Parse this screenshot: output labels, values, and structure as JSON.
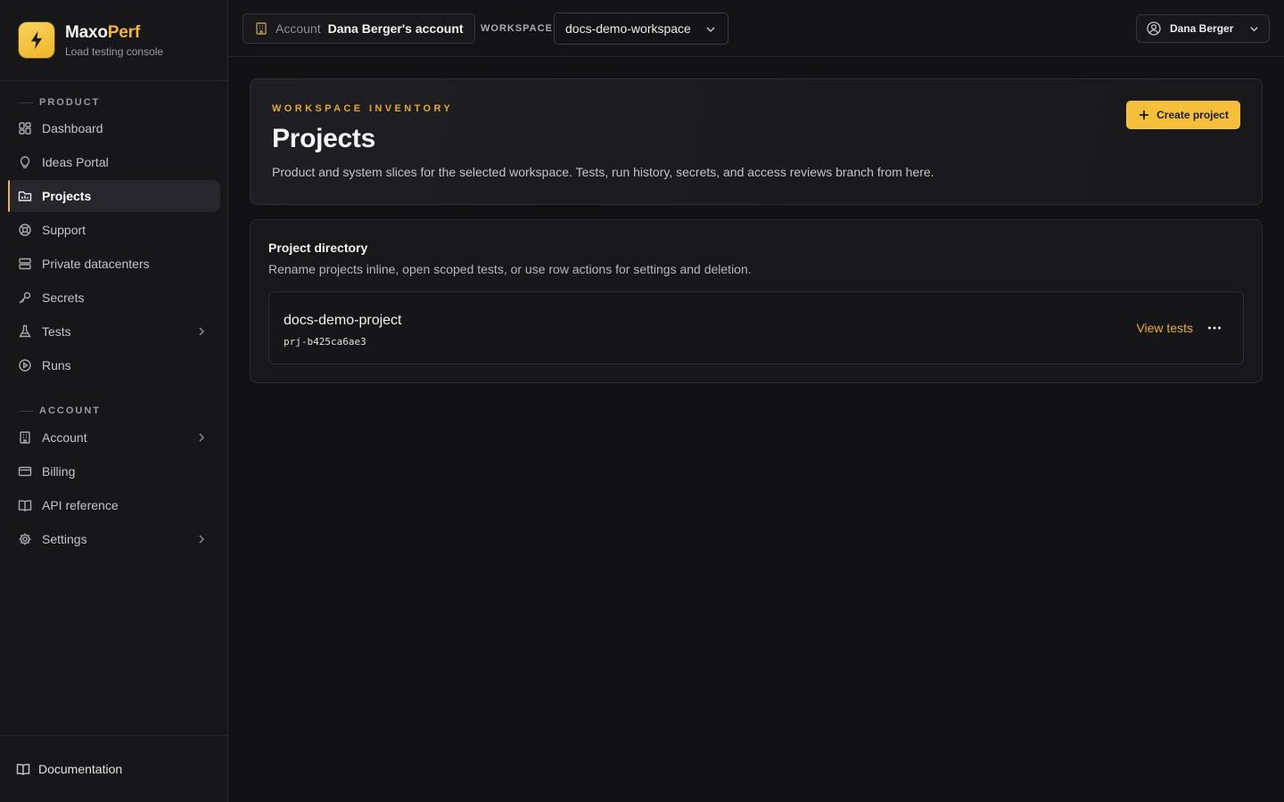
{
  "brand": {
    "name_main": "Maxo",
    "name_accent": "Perf",
    "subtitle": "Load testing console",
    "logo_icon": "lightning-bolt-icon",
    "accent_color": "#f2b53a"
  },
  "sidebar": {
    "product_label": "PRODUCT",
    "product_items": [
      {
        "label": "Dashboard",
        "icon": "grid-icon"
      },
      {
        "label": "Ideas Portal",
        "icon": "lightbulb-icon"
      },
      {
        "label": "Projects",
        "icon": "folder-chart-icon",
        "active": true
      },
      {
        "label": "Support",
        "icon": "lifebuoy-icon"
      },
      {
        "label": "Private datacenters",
        "icon": "server-icon"
      },
      {
        "label": "Secrets",
        "icon": "key-icon"
      },
      {
        "label": "Tests",
        "icon": "flask-icon",
        "expandable": true
      },
      {
        "label": "Runs",
        "icon": "play-circle-icon"
      }
    ],
    "account_label": "ACCOUNT",
    "account_items": [
      {
        "label": "Account",
        "icon": "building-icon",
        "expandable": true
      },
      {
        "label": "Billing",
        "icon": "credit-card-icon"
      },
      {
        "label": "API reference",
        "icon": "book-icon"
      },
      {
        "label": "Settings",
        "icon": "gear-icon",
        "expandable": true
      }
    ],
    "footer_label": "Documentation"
  },
  "topbar": {
    "account_label": "Account",
    "account_value": "Dana Berger's account",
    "workspace_label": "WORKSPACE",
    "workspace_value": "docs-demo-workspace",
    "user_name": "Dana Berger"
  },
  "hero": {
    "eyebrow": "WORKSPACE INVENTORY",
    "title": "Projects",
    "description": "Product and system slices for the selected workspace. Tests, run history, secrets, and access reviews branch from here.",
    "create_button": "Create project"
  },
  "directory": {
    "title": "Project directory",
    "description": "Rename projects inline, open scoped tests, or use row actions for settings and deletion.",
    "projects": [
      {
        "name": "docs-demo-project",
        "id": "prj-b425ca6ae3",
        "action": "View tests"
      }
    ]
  }
}
